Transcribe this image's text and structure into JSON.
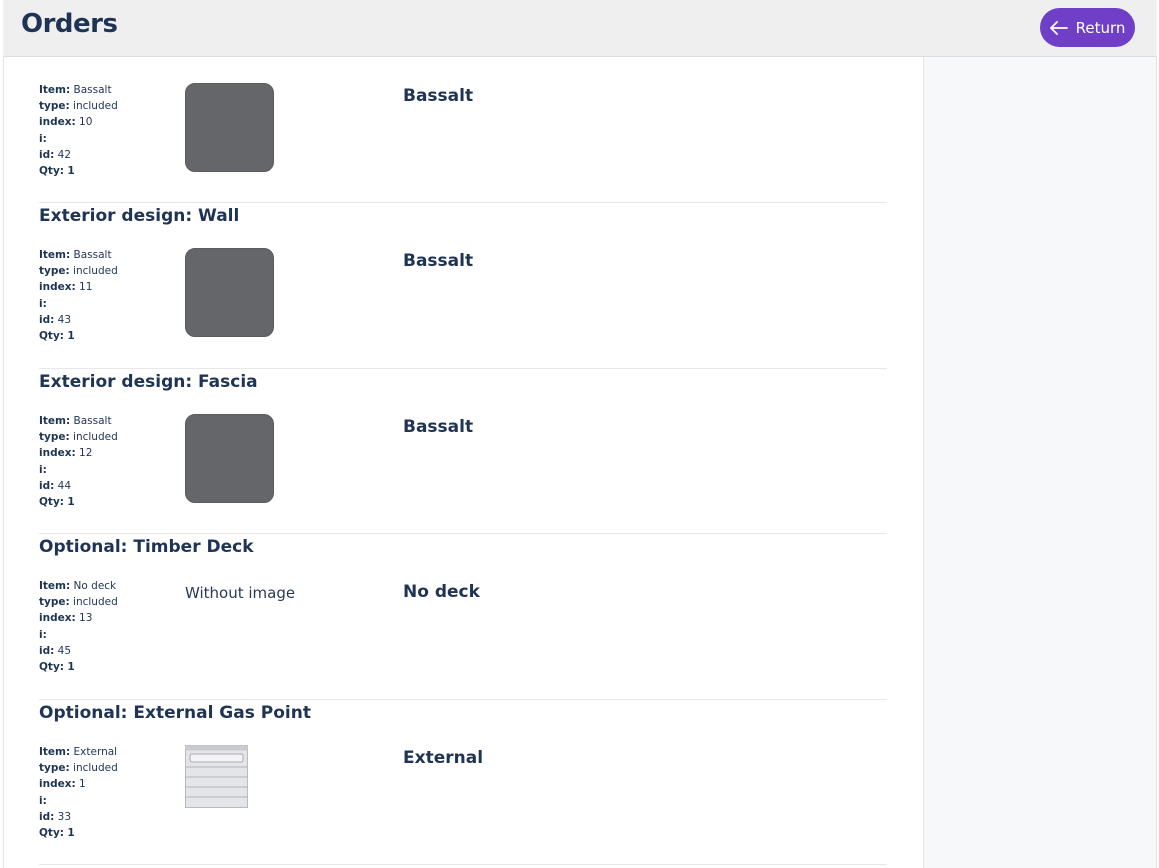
{
  "header": {
    "title": "Orders",
    "return_label": "Return"
  },
  "sections": [
    {
      "title": "",
      "meta": {
        "item": "Bassalt",
        "type": "included",
        "index": "10",
        "i": "",
        "id": "42",
        "qty": "1"
      },
      "image": "swatch-dark-gray",
      "name": "Bassalt"
    },
    {
      "title": "Exterior design: Wall",
      "meta": {
        "item": "Bassalt",
        "type": "included",
        "index": "11",
        "i": "",
        "id": "43",
        "qty": "1"
      },
      "image": "swatch-dark-gray",
      "name": "Bassalt"
    },
    {
      "title": "Exterior design: Fascia",
      "meta": {
        "item": "Bassalt",
        "type": "included",
        "index": "12",
        "i": "",
        "id": "44",
        "qty": "1"
      },
      "image": "swatch-dark-gray",
      "name": "Bassalt"
    },
    {
      "title": "Optional: Timber Deck",
      "meta": {
        "item": "No deck",
        "type": "included",
        "index": "13",
        "i": "",
        "id": "45",
        "qty": "1"
      },
      "image_text": "Without image",
      "name": "No deck"
    },
    {
      "title": "Optional: External Gas Point",
      "meta": {
        "item": "External",
        "type": "included",
        "index": "1",
        "i": "",
        "id": "33",
        "qty": "1"
      },
      "image": "gas-box-thumbnail",
      "name": "External"
    }
  ],
  "labels": {
    "item": "Item:",
    "type": "type:",
    "index": "index:",
    "i": "i:",
    "id": "id:",
    "qty": "Qty:"
  },
  "colors": {
    "accent": "#6f3fc8",
    "heading": "#1f3454",
    "swatch": "#65666a"
  }
}
